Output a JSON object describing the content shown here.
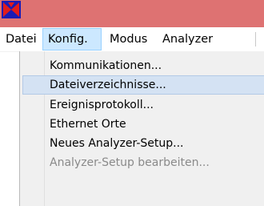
{
  "colors": {
    "titlebar": "#de7272",
    "menu_active_bg": "#cce8ff",
    "dropdown_bg": "#f0f0f0",
    "highlight_bg": "#d4e2f3",
    "disabled_text": "#8a8a8a",
    "logo_blue": "#1b1bb4",
    "logo_red": "#e21b1b"
  },
  "titlebar": {
    "icon": "app-logo-icon"
  },
  "menubar": {
    "items": [
      {
        "label": "Datei"
      },
      {
        "label": "Konfig."
      },
      {
        "label": "Modus"
      },
      {
        "label": "Analyzer"
      }
    ]
  },
  "dropdown": {
    "items": [
      {
        "label": "Kommunikationen...",
        "state": "enabled"
      },
      {
        "label": "Dateiverzeichnisse...",
        "state": "highlighted"
      },
      {
        "label": "Ereignisprotokoll...",
        "state": "enabled"
      },
      {
        "label": "Ethernet Orte",
        "state": "enabled"
      },
      {
        "label": "Neues Analyzer-Setup...",
        "state": "enabled"
      },
      {
        "label": "Analyzer-Setup bearbeiten...",
        "state": "disabled"
      }
    ]
  }
}
